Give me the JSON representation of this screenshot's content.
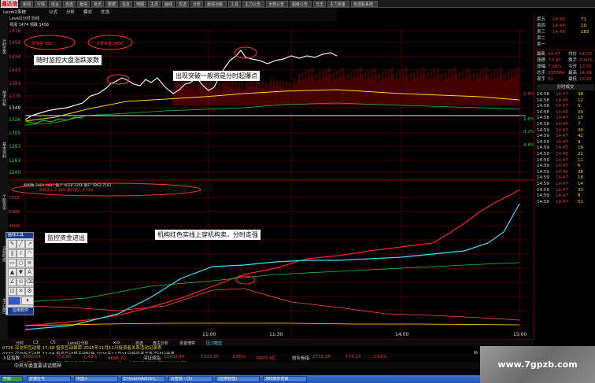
{
  "toolbar": {
    "logo": "通达信",
    "buttons": [
      "新闻",
      "行情",
      "综合",
      "自选",
      "板块",
      "资讯",
      "数据",
      "信息",
      "地图",
      "主页",
      "画线",
      "优选",
      "分析",
      "最强功能",
      "工具",
      "主力公告",
      "全部公告",
      "超级公告",
      "日志",
      "主力资金",
      "自选股系统"
    ]
  },
  "menubar": {
    "items": [
      "Level2系统",
      "公式",
      "分析",
      "模式",
      "优选"
    ]
  },
  "left_tabs": [
    "分时走势",
    "技术分析",
    "基本资料",
    "个股资讯",
    "五档明细",
    "主力监控"
  ],
  "chart": {
    "header_top": "Level2分时  均线  ",
    "header_sub": "领涨 1474  领跌 1456",
    "price_labels": [
      "1478",
      "1456",
      "1434",
      "1413",
      "1391",
      "1370",
      "1349",
      "1326",
      "1305",
      "1283",
      "1261",
      "1240"
    ],
    "pct_labels": [
      "1.6%",
      "1.6%",
      "3.2%",
      "4.8%"
    ],
    "time_labels": [
      "11:00",
      "11:30",
      "14:00",
      "15:00"
    ],
    "lower_labels": [
      "7521",
      "6000",
      "4500"
    ],
    "mini_labels_1": "机构数  7869  9897  散户  9028  2266  散户  5963  7161",
    "mini_labels_2": "机构流入 0.46%   散户流入 0.73%",
    "chart_title_box1": "领涨股  151",
    "chart_title_box2": "大单资金  1456"
  },
  "annotations": {
    "note1": "随时监控大盘涨跌家数",
    "note2": "出现突破一般将是分时起爆点",
    "note3": "监控资金进出",
    "note4": "机构红色实线上穿机构卖，分时走强"
  },
  "draw_tool": {
    "title": "画线工具",
    "footer": "应用软件"
  },
  "right_panel": {
    "quotes": [
      {
        "label": "卖五",
        "price": "14.50",
        "vol": "71"
      },
      {
        "label": "卖四",
        "price": "14.49",
        "vol": "10"
      },
      {
        "label": "卖三",
        "price": "14.48",
        "vol": "182"
      },
      {
        "label": "卖二",
        "price": "",
        "vol": ""
      },
      {
        "label": "卖一",
        "price": "",
        "vol": ""
      }
    ],
    "stats": [
      {
        "k": "最新",
        "v": "14.47",
        "k2": "均价",
        "v2": "14.33"
      },
      {
        "k": "涨跌",
        "v": "↑0.97",
        "k2": "换手",
        "v2": "2.40%"
      },
      {
        "k": "涨幅",
        "v": "7.34%",
        "k2": "今开",
        "v2": "13.55"
      },
      {
        "k": "总手",
        "v": "235564",
        "k2": "最高",
        "v2": "14.49"
      },
      {
        "k": "现手",
        "v": "51",
        "k2": "最低",
        "v2": "13.42"
      }
    ],
    "trades_header": "分时成交",
    "trades": [
      {
        "t": "14:58",
        "p": "14.47",
        "v": "38"
      },
      {
        "t": "14:58",
        "p": "14.45",
        "v": "12"
      },
      {
        "t": "14:58",
        "p": "14.47",
        "v": "5"
      },
      {
        "t": "14:58",
        "p": "14.46",
        "v": "20"
      },
      {
        "t": "14:58",
        "p": "14.47",
        "v": "15"
      },
      {
        "t": "14:58",
        "p": "14.46",
        "v": "7"
      },
      {
        "t": "14:59",
        "p": "14.47",
        "v": "30"
      },
      {
        "t": "14:59",
        "p": "14.47",
        "v": "42"
      },
      {
        "t": "14:59",
        "p": "14.47",
        "v": "9"
      },
      {
        "t": "14:59",
        "p": "14.45",
        "v": "16"
      },
      {
        "t": "14:59",
        "p": "14.46",
        "v": "22"
      },
      {
        "t": "14:59",
        "p": "14.47",
        "v": "11"
      },
      {
        "t": "14:59",
        "p": "14.47",
        "v": "6"
      },
      {
        "t": "14:59",
        "p": "14.46",
        "v": "28"
      },
      {
        "t": "14:59",
        "p": "14.47",
        "v": "18"
      },
      {
        "t": "14:59",
        "p": "14.47",
        "v": "14"
      },
      {
        "t": "14:59",
        "p": "14.47",
        "v": "33"
      },
      {
        "t": "14:59",
        "p": "14.47",
        "v": "8"
      },
      {
        "t": "14:59",
        "p": "14.47",
        "v": "51"
      }
    ],
    "side_label": "监控"
  },
  "bottom_tabs": [
    "分时",
    "C3",
    "C5",
    "Level2分析",
    "xxx",
    "自选",
    "盘古分析",
    "资金博弈",
    "压力模型"
  ],
  "news": [
    "0726 深交所互动易 17:58 投资互动易荣 2015年11月11日投资者关系活动记录表",
    "0772 深交所互动易 17:58 投资互动易天欣科技 2015年11月11日投资者关系活动记录表",
    "0735 深交所互动易 17:58 投资互动易瑞智股份 2015年11月11日路演活动附件之机构调研纪要",
    "0373 深交所互动易 17:58 投资互动易鑫股份 2015年11月11日投资者关系活动记录表"
  ],
  "ticker": [
    {
      "name": "上证指数",
      "val": "3580.84",
      "chg": "↑52.86",
      "pct": "1.43%",
      "amt": "4686.7亿"
    },
    {
      "name": "深证成指",
      "val": "12402.84",
      "chg": "↑233.35",
      "pct": "1.85%",
      "amt": "6693.4亿"
    },
    {
      "name": "创业板指",
      "val": "2718.16",
      "chg": "↑73.14",
      "pct": "2.61%",
      "amt": ""
    }
  ],
  "marquee": "中央军委重要讲话精神",
  "taskbar": {
    "start": "开始",
    "items": [
      "爱德生号",
      "中国人",
      "E:\\Users\\Admin\\...",
      "大智慧 - (1)",
      "(应用管理)",
      "360软件管家"
    ]
  },
  "watermark": "www.7gpzb.com",
  "colors": {
    "accent": "#ff3030",
    "up": "#ff3030",
    "down": "#20e020",
    "grid": "#5a0000"
  }
}
